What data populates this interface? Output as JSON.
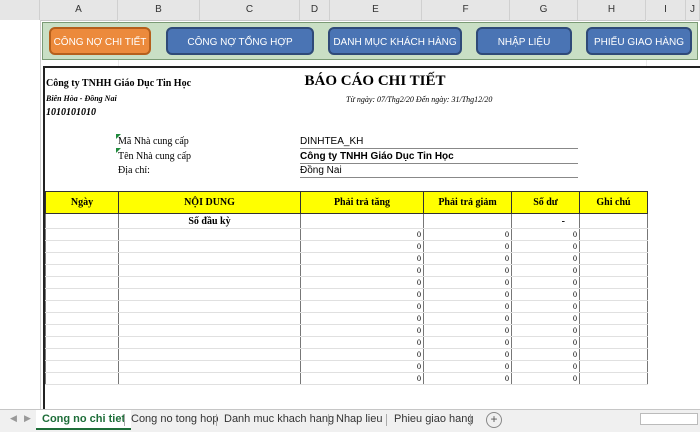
{
  "columns": [
    "A",
    "B",
    "C",
    "D",
    "E",
    "F",
    "G",
    "H",
    "I",
    "J"
  ],
  "buttons": {
    "cong_no_chi_tiet": "CÔNG NỢ CHI TIẾT",
    "cong_no_tong_hop": "CÔNG NỢ TỔNG HỢP",
    "danh_muc_khach_hang": "DANH MỤC KHÁCH HÀNG",
    "nhap_lieu": "NHẬP LIỆU",
    "phieu_giao_hang": "PHIẾU GIAO HÀNG"
  },
  "company": {
    "name": "Công ty TNHH Giáo Dục Tin Học",
    "address": "Biên Hòa - Đồng Nai",
    "code": "1010101010"
  },
  "report": {
    "title": "BÁO CÁO CHI TIẾT",
    "date_range": "Từ ngày: 07/Thg2/20  Đến ngày: 31/Thg12/20"
  },
  "supplier": {
    "code_label": "Mã Nhà cung cấp",
    "code_value": "DINHTEA_KH",
    "name_label": "Tên Nhà cung cấp",
    "name_value": "Công ty TNHH Giáo Dục Tin Học",
    "address_label": "Địa chỉ:",
    "address_value": "Đồng Nai"
  },
  "table": {
    "headers": [
      "Ngày",
      "NỘI DUNG",
      "Phải trả tăng",
      "Phải trả giảm",
      "Số dư",
      "Ghi chú"
    ],
    "opening_label": "Số đầu kỳ",
    "opening_balance": "-",
    "zero_rows": 13,
    "zero_value": "0"
  },
  "sheet_tabs": [
    "Cong no chi tiet",
    "Cong no tong hop",
    "Danh muc khach hang",
    "Nhap lieu",
    "Phieu giao hang"
  ],
  "active_tab": "Cong no chi tiet",
  "colors": {
    "active_button": "#ec8a3c",
    "button": "#4a74b4",
    "header_fill": "#ffff00",
    "tab_green": "#1e6e39"
  }
}
